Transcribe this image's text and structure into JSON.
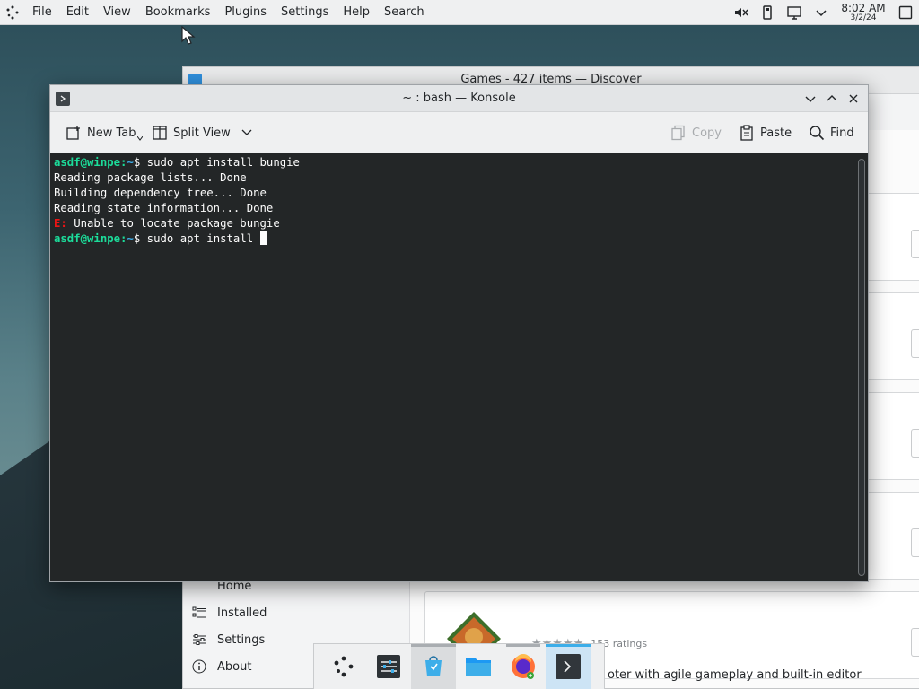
{
  "topbar": {
    "menus": [
      "File",
      "Edit",
      "View",
      "Bookmarks",
      "Plugins",
      "Settings",
      "Help",
      "Search"
    ],
    "clock_time": "8:02 AM",
    "clock_date": "3/2/24",
    "tray_icons": [
      "muted-speaker-icon",
      "usb-icon",
      "network-icon",
      "chevron-down-icon",
      "show-desktop-icon"
    ]
  },
  "discover": {
    "title": "Games - 427 items — Discover",
    "sidebar": [
      "Home",
      "Installed",
      "Settings",
      "About"
    ],
    "rating_stars": "★★★★★",
    "rating_count": "153 ratings",
    "visible_description": "oter with agile gameplay and built-in editor"
  },
  "konsole": {
    "title": "~ : bash — Konsole",
    "toolbar": {
      "new_tab": "New Tab",
      "split_view": "Split View",
      "copy": "Copy",
      "paste": "Paste",
      "find": "Find"
    },
    "terminal": {
      "user_host": "asdf@winpe",
      "path": "~",
      "cmd1": "sudo apt install bungie",
      "out1": "Reading package lists... Done",
      "out2": "Building dependency tree... Done",
      "out3": "Reading state information... Done",
      "err_prefix": "E:",
      "err_msg": " Unable to locate package bungie",
      "cmd2": "sudo apt install "
    }
  },
  "dock": {
    "items": [
      "app-launcher",
      "system-settings",
      "discover",
      "dolphin-file-manager",
      "firefox",
      "konsole"
    ]
  },
  "colors": {
    "terminal_bg": "#232627",
    "prompt_user": "#1cdc9a",
    "prompt_path": "#3daee9",
    "error": "#ed1515",
    "accent": "#3daee9"
  }
}
